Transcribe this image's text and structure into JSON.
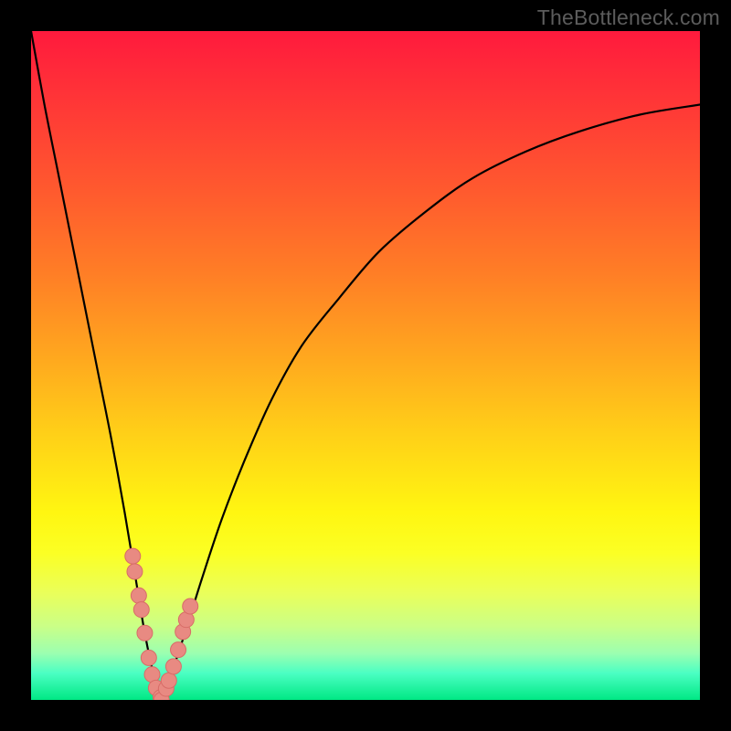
{
  "attribution": "TheBottleneck.com",
  "colors": {
    "frame": "#000000",
    "curve": "#000000",
    "marker_fill": "#e88a82",
    "marker_stroke": "#d86c67"
  },
  "chart_data": {
    "type": "line",
    "title": "",
    "xlabel": "",
    "ylabel": "",
    "xlim": [
      0,
      100
    ],
    "ylim": [
      0,
      100
    ],
    "grid": false,
    "legend": false,
    "series": [
      {
        "name": "curve-left",
        "x": [
          0,
          2,
          4,
          6,
          8,
          10,
          12,
          14,
          15.5,
          17,
          18.5,
          19.5
        ],
        "y": [
          100,
          89,
          79,
          69,
          59,
          49,
          39,
          28,
          19,
          10,
          3,
          0
        ]
      },
      {
        "name": "curve-right",
        "x": [
          19.5,
          21,
          23,
          25.5,
          28.5,
          32,
          36,
          40.5,
          46,
          52,
          59,
          66,
          74,
          82,
          91,
          100
        ],
        "y": [
          0,
          4,
          10,
          18,
          27,
          36,
          45,
          53,
          60,
          67,
          73,
          78,
          82,
          85,
          87.5,
          89
        ]
      }
    ],
    "markers": {
      "name": "data-points",
      "x": [
        15.2,
        15.5,
        16.1,
        16.5,
        17.0,
        17.6,
        18.1,
        18.7,
        19.4,
        19.5,
        20.2,
        20.6,
        21.3,
        22.0,
        22.7,
        23.2,
        23.8
      ],
      "y": [
        21.5,
        19.2,
        15.6,
        13.5,
        10.0,
        6.3,
        3.8,
        1.8,
        0.4,
        0.0,
        1.7,
        2.9,
        5.0,
        7.5,
        10.2,
        12.0,
        14.0
      ]
    }
  }
}
